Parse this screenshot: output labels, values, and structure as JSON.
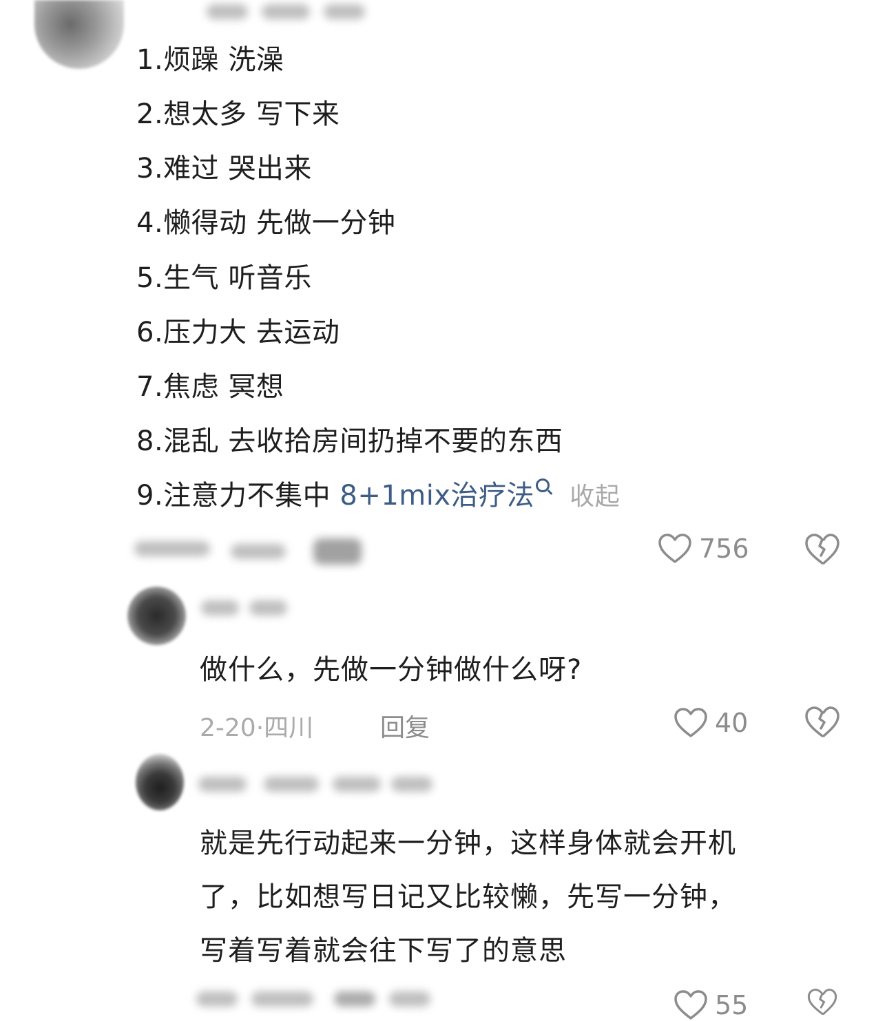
{
  "comment": {
    "items": [
      "1.烦躁 洗澡",
      "2.想太多 写下来",
      "3.难过 哭出来",
      "4.懒得动 先做一分钟",
      "5.生气 听音乐",
      "6.压力大 去运动",
      "7.焦虑 冥想",
      "8.混乱 去收拾房间扔掉不要的东西",
      "9.注意力不集中"
    ],
    "search_link": "8+1mix治疗法",
    "collapse_label": "收起",
    "like_count": "756"
  },
  "reply1": {
    "text": "做什么，先做一分钟做什么呀?",
    "date": "2-20",
    "location": "四川",
    "reply_label": "回复",
    "like_count": "40"
  },
  "reply2": {
    "lines": [
      "就是先行动起来一分钟，这样身体就会开机",
      "了，比如想写日记又比较懒，先写一分钟，",
      "写着写着就会往下写了的意思"
    ],
    "like_count": "55"
  },
  "colors": {
    "text": "#1e1e1e",
    "link": "#3d5d86",
    "muted": "#aaaaaa",
    "icon": "#8c8c8c"
  },
  "icons": [
    "heart-outline-icon",
    "broken-heart-icon",
    "search-icon"
  ]
}
